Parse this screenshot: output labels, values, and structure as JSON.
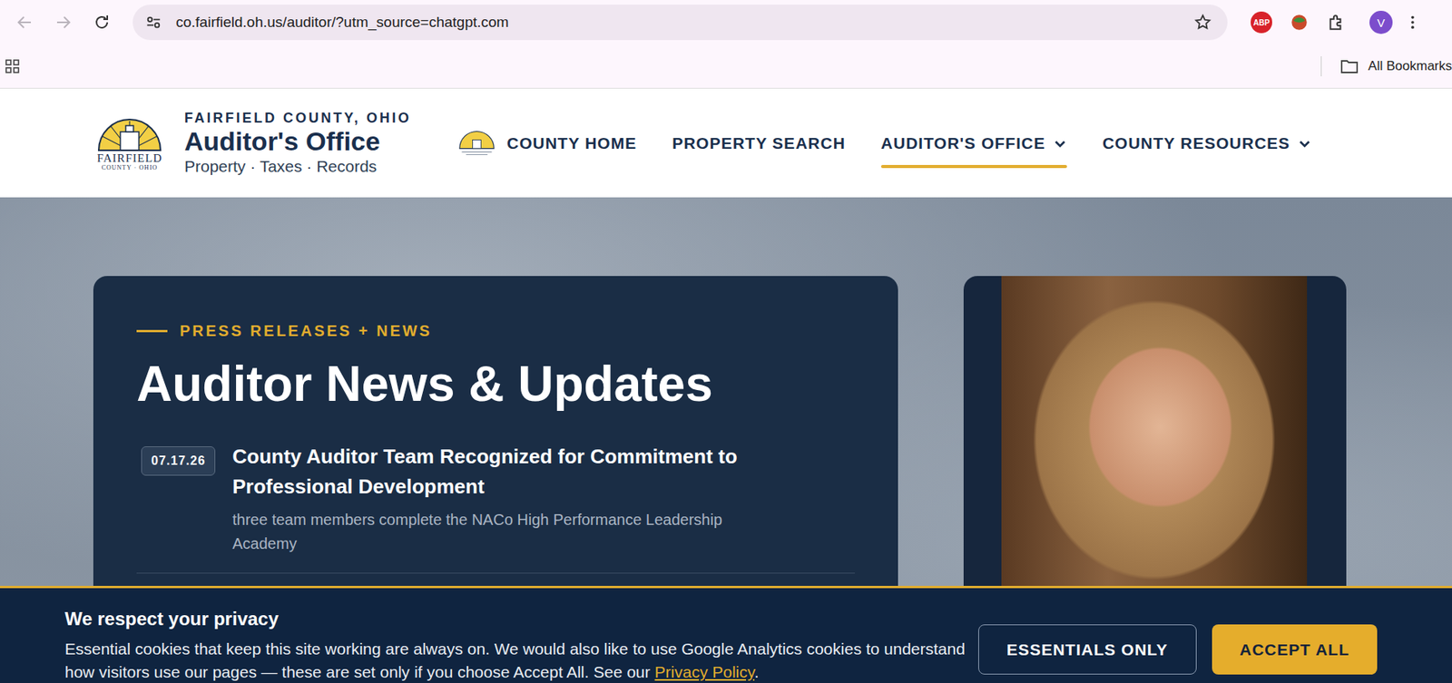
{
  "browser": {
    "url": "co.fairfield.oh.us/auditor/?utm_source=chatgpt.com",
    "back_disabled": true,
    "forward_disabled": true,
    "extension_badge": "ABP",
    "profile": "V",
    "bookmarks_label": "All Bookmarks"
  },
  "site_header": {
    "logo": {
      "name": "FAIRFIELD",
      "sub": "COUNTY · OHIO"
    },
    "county": "FAIRFIELD COUNTY, OHIO",
    "title": "Auditor's Office",
    "tagline": "Property · Taxes · Records"
  },
  "nav": [
    {
      "label": "COUNTY HOME",
      "selected": false,
      "dropdown": false,
      "has_logo": true
    },
    {
      "label": "PROPERTY SEARCH",
      "selected": false,
      "dropdown": false,
      "has_logo": false
    },
    {
      "label": "AUDITOR'S OFFICE",
      "selected": true,
      "dropdown": true,
      "has_logo": false
    },
    {
      "label": "COUNTY RESOURCES",
      "selected": false,
      "dropdown": true,
      "has_logo": false
    }
  ],
  "news": {
    "eyebrow": "PRESS RELEASES + NEWS",
    "heading": "Auditor News & Updates",
    "items": [
      {
        "date": "07.17.26",
        "title": "County Auditor Team Recognized for Commitment to Professional Development",
        "summary": "three team members complete the NACo High Performance Leadership Academy"
      }
    ]
  },
  "cookie_banner": {
    "title": "We respect your privacy",
    "text": "Essential cookies that keep this site working are always on. We would also like to use Google Analytics cookies to understand how visitors use our pages — these are set only if you choose Accept All. See our",
    "link": "Privacy Policy",
    "text_end": ".",
    "buttons": [
      {
        "label": "ESSENTIALS ONLY",
        "primary": false
      },
      {
        "label": "ACCEPT ALL",
        "primary": true
      }
    ]
  }
}
